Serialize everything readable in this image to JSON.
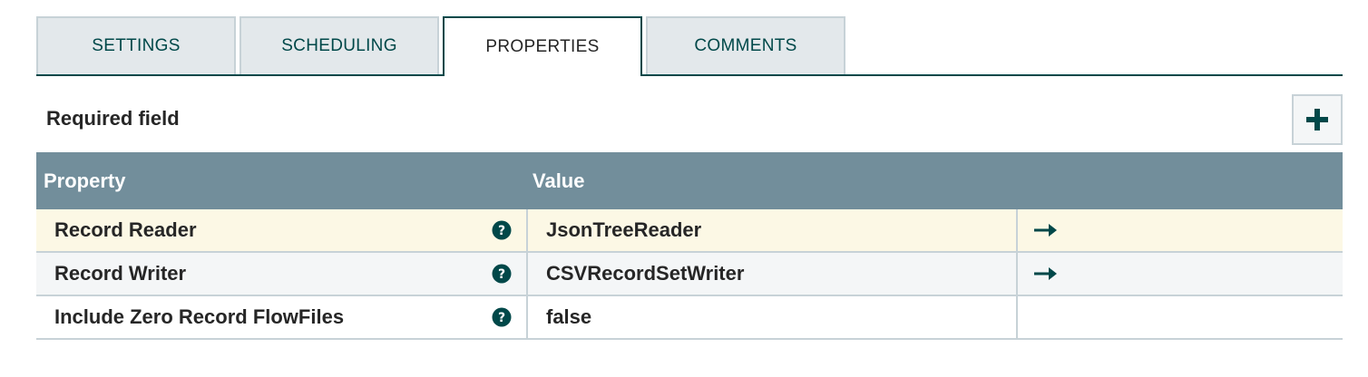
{
  "tabs": [
    {
      "label": "SETTINGS",
      "active": false
    },
    {
      "label": "SCHEDULING",
      "active": false
    },
    {
      "label": "PROPERTIES",
      "active": true
    },
    {
      "label": "COMMENTS",
      "active": false
    }
  ],
  "required_label": "Required field",
  "add_icon": "plus-icon",
  "table": {
    "headers": {
      "property": "Property",
      "value": "Value"
    },
    "rows": [
      {
        "name": "Record Reader",
        "value": "JsonTreeReader",
        "help_icon": "question-circle-icon",
        "goto_icon": "arrow-right-icon"
      },
      {
        "name": "Record Writer",
        "value": "CSVRecordSetWriter",
        "help_icon": "question-circle-icon",
        "goto_icon": "arrow-right-icon"
      },
      {
        "name": "Include Zero Record FlowFiles",
        "value": "false",
        "help_icon": "question-circle-icon",
        "goto_icon": ""
      }
    ]
  },
  "colors": {
    "accent": "#004849",
    "header_bg": "#728e9b",
    "tab_bg": "#e3e8eb",
    "selected_row_bg": "#fcf8e5"
  }
}
